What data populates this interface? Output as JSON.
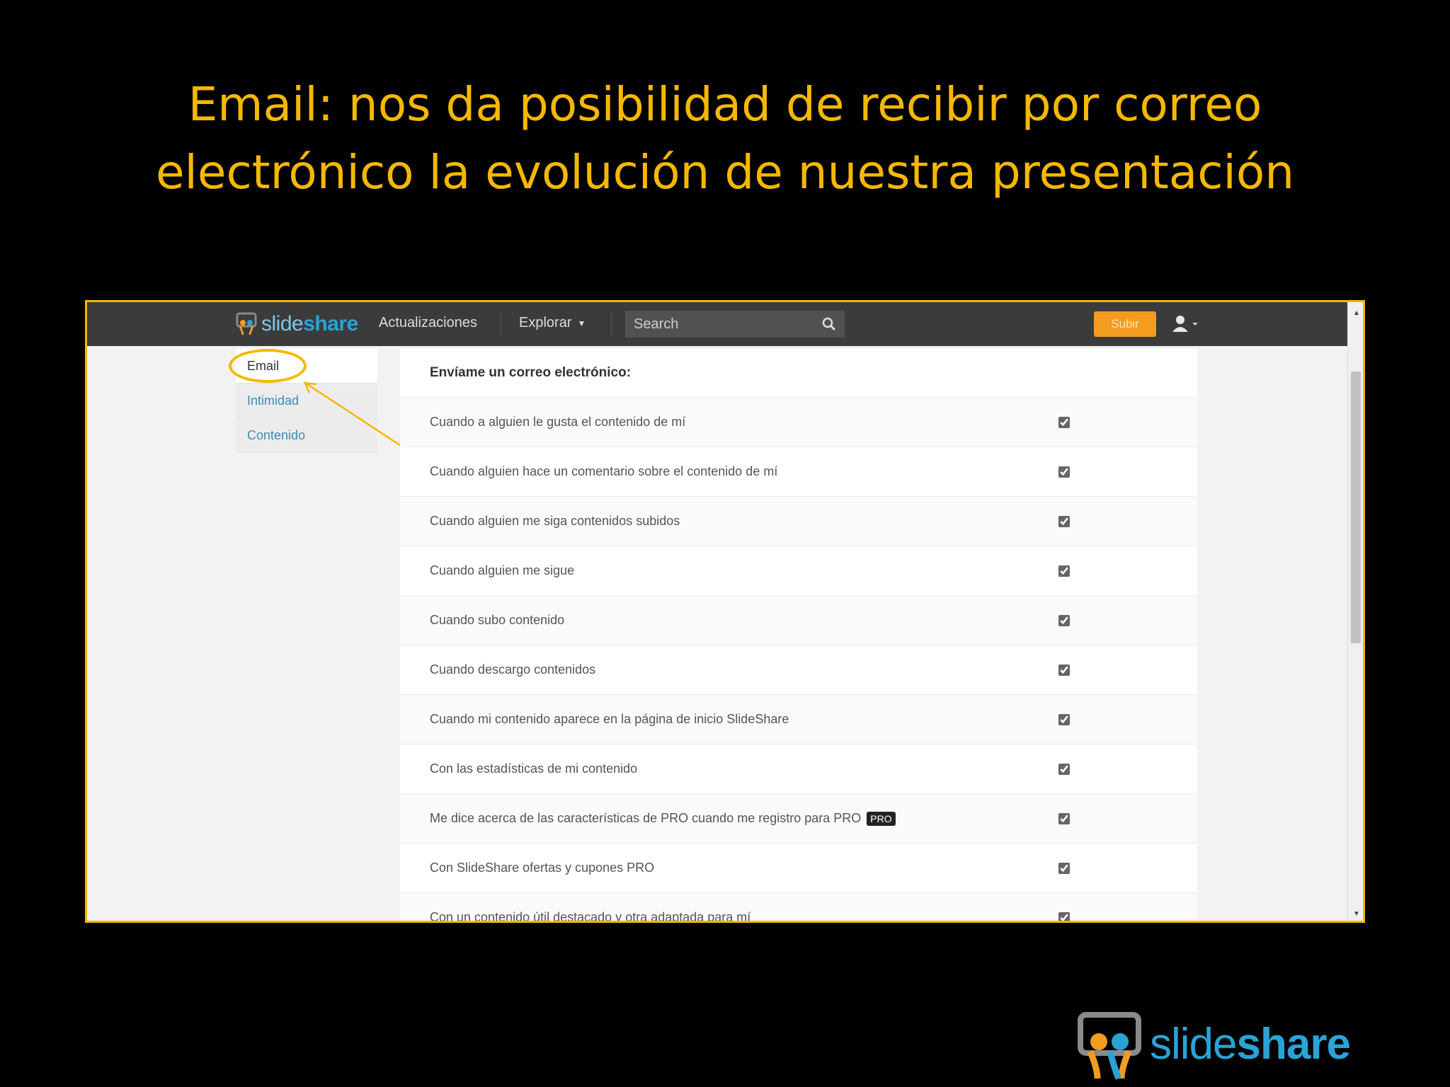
{
  "slide": {
    "title_line1": "Email: nos da posibilidad de recibir por correo",
    "title_line2": "electrónico la evolución de nuestra presentación"
  },
  "topbar": {
    "brand_light": "slide",
    "brand_bold": "share",
    "nav_updates": "Actualizaciones",
    "nav_explore": "Explorar",
    "search_placeholder": "Search",
    "upload_label": "Subir"
  },
  "sidebar": {
    "items": [
      {
        "label": "Email",
        "active": true
      },
      {
        "label": "Intimidad",
        "active": false
      },
      {
        "label": "Contenido",
        "active": false
      }
    ]
  },
  "panel": {
    "header": "Envíame un correo electrónico:",
    "rows": [
      {
        "label": "Cuando a alguien le gusta el contenido de mí",
        "checked": true
      },
      {
        "label": "Cuando alguien hace un comentario sobre el contenido de mí",
        "checked": true
      },
      {
        "label": "Cuando alguien me siga contenidos subidos",
        "checked": true
      },
      {
        "label": "Cuando alguien me sigue",
        "checked": true
      },
      {
        "label": "Cuando subo contenido",
        "checked": true
      },
      {
        "label": "Cuando descargo contenidos",
        "checked": true
      },
      {
        "label": "Cuando mi contenido aparece en la página de inicio SlideShare",
        "checked": true
      },
      {
        "label": "Con las estadísticas de mi contenido",
        "checked": true
      },
      {
        "label": "Me dice acerca de las características de PRO cuando me registro para PRO",
        "badge": "PRO",
        "checked": true
      },
      {
        "label": "Con SlideShare ofertas y cupones PRO",
        "checked": true
      },
      {
        "label": "Con un contenido útil destacado y otra adaptada para mí",
        "checked": true
      }
    ]
  },
  "footer_logo": {
    "light": "slide",
    "bold": "share"
  },
  "colors": {
    "title": "#f5b800",
    "brand": "#2aa3d6",
    "accent_orange": "#f39c20",
    "topbar": "#3b3b3b"
  },
  "icons": [
    "slideshare-logo-icon",
    "search-icon",
    "user-icon",
    "chevron-down-icon",
    "arrow-annotation-icon"
  ]
}
